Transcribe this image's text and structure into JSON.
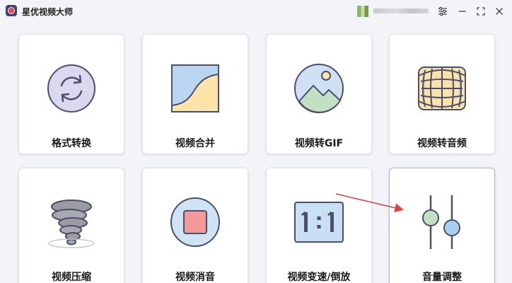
{
  "app": {
    "title": "星优视频大师"
  },
  "header": {
    "user_name": ""
  },
  "tools": [
    {
      "label": "格式转换"
    },
    {
      "label": "视频合并"
    },
    {
      "label": "视频转GIF"
    },
    {
      "label": "视频转音频"
    },
    {
      "label": "视频压缩"
    },
    {
      "label": "视频消音"
    },
    {
      "label": "视频变速/倒放"
    },
    {
      "label": "音量调整"
    }
  ],
  "icons": {
    "settings": "sliders-icon",
    "minimize": "minimize-icon",
    "maximize": "maximize-icon",
    "close": "close-icon"
  },
  "colors": {
    "accent": "#3b3f7a",
    "icon_purple": "#d8d6ee",
    "icon_outline": "#4a4f6e",
    "arrow": "#d9453b"
  }
}
